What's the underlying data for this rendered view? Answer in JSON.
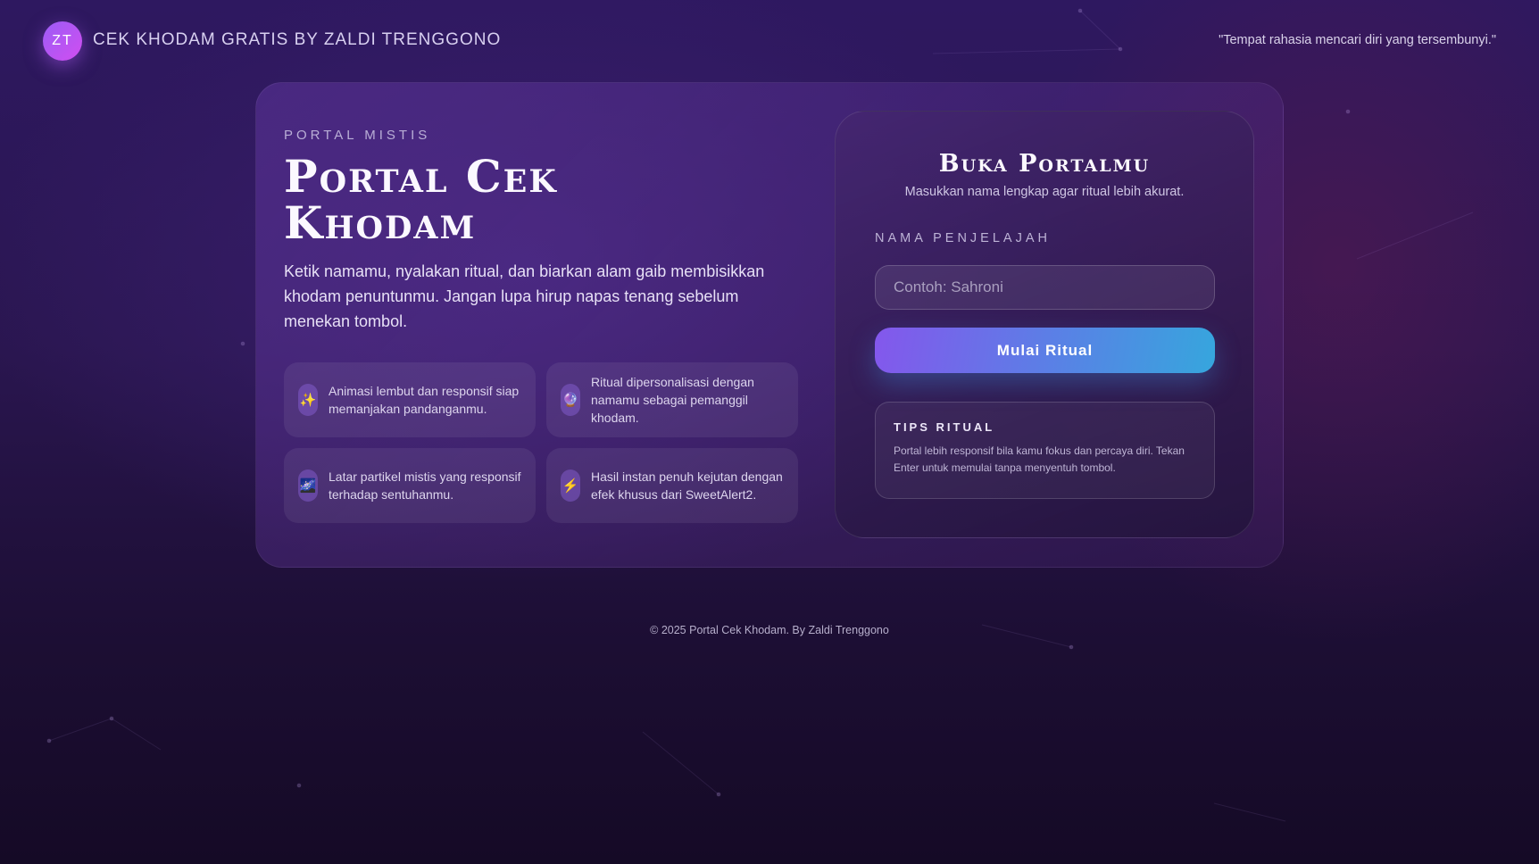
{
  "header": {
    "avatar_initials": "ZT",
    "brand": "CEK KHODAM GRATIS BY ZALDI TRENGGONO",
    "quote": "\"Tempat rahasia mencari diri yang tersembunyi.\""
  },
  "hero": {
    "eyebrow": "PORTAL MISTIS",
    "title": "Portal Cek Khodam",
    "intro": "Ketik namamu, nyalakan ritual, dan biarkan alam gaib membisikkan khodam penuntunmu. Jangan lupa hirup napas tenang sebelum menekan tombol."
  },
  "features": [
    {
      "icon": "sparkles-icon",
      "glyph": "✨",
      "text": "Animasi lembut dan responsif siap memanjakan pandanganmu."
    },
    {
      "icon": "crystal-ball-icon",
      "glyph": "🔮",
      "text": "Ritual dipersonalisasi dengan namamu sebagai pemanggil khodam."
    },
    {
      "icon": "milky-way-icon",
      "glyph": "🌌",
      "text": "Latar partikel mistis yang responsif terhadap sentuhanmu."
    },
    {
      "icon": "lightning-icon",
      "glyph": "⚡",
      "text": "Hasil instan penuh kejutan dengan efek khusus dari SweetAlert2."
    }
  ],
  "form": {
    "title": "Buka Portalmu",
    "subtitle": "Masukkan nama lengkap agar ritual lebih akurat.",
    "label": "NAMA PENJELAJAH",
    "placeholder": "Contoh: Sahroni",
    "value": "",
    "button": "Mulai Ritual"
  },
  "tips": {
    "title": "TIPS RITUAL",
    "text": "Portal lebih responsif bila kamu fokus dan percaya diri. Tekan Enter untuk memulai tanpa menyentuh tombol."
  },
  "footer": "© 2025 Portal Cek Khodam. By Zaldi Trenggono"
}
